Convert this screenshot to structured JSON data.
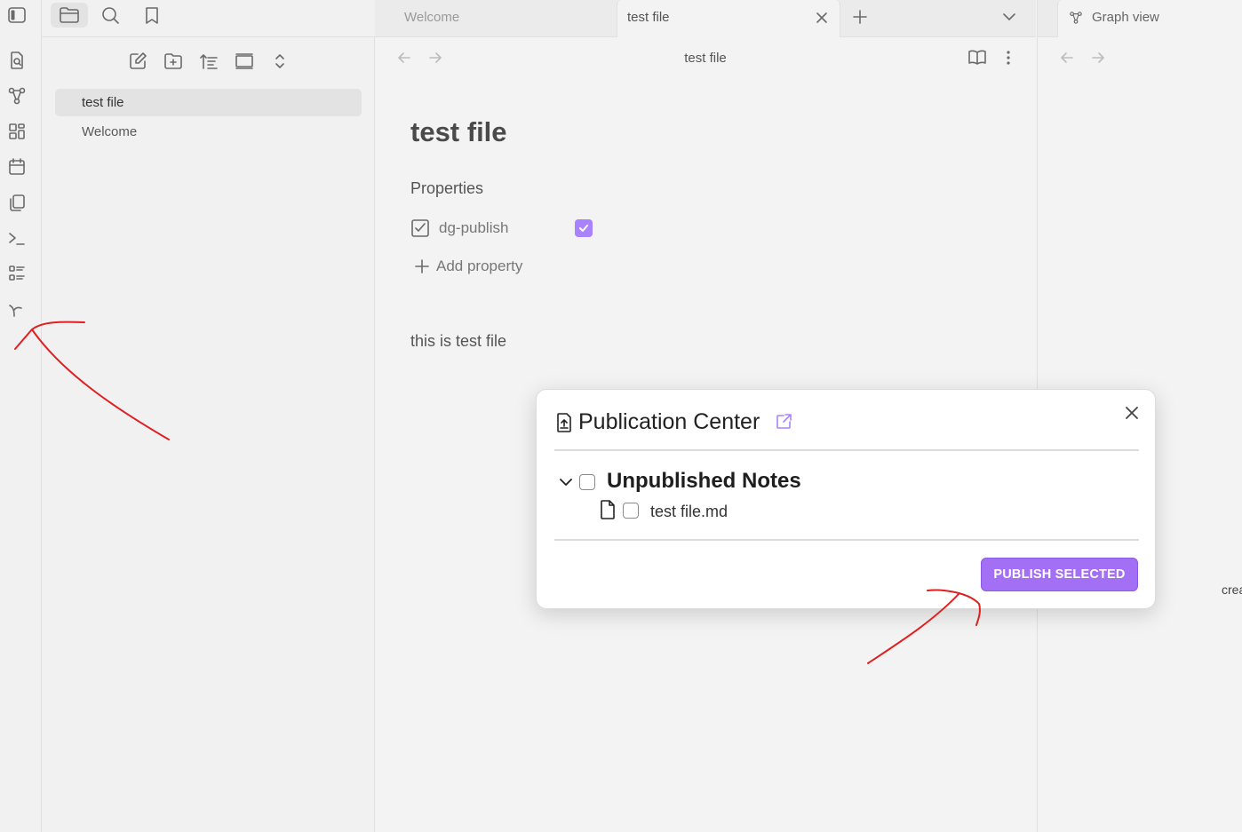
{
  "ribbon": {
    "icons": [
      "sidebar-toggle-icon",
      "search-file-icon",
      "graph-icon",
      "canvas-icon",
      "calendar-icon",
      "copy-icon",
      "terminal-icon",
      "list-icon",
      "publish-sprout-icon"
    ]
  },
  "left_panel": {
    "top_icons": [
      "folder-icon",
      "search-icon",
      "bookmark-icon"
    ],
    "nav_icons": [
      "new-note-icon",
      "new-folder-icon",
      "sort-icon",
      "collapse-icon",
      "expand-icon"
    ],
    "files": [
      {
        "label": "test file",
        "active": true
      },
      {
        "label": "Welcome",
        "active": false
      }
    ]
  },
  "tabs": [
    {
      "label": "Welcome",
      "active": false
    },
    {
      "label": "test file",
      "active": true
    }
  ],
  "note": {
    "view_title": "test file",
    "title": "test file",
    "properties_heading": "Properties",
    "property": {
      "name": "dg-publish",
      "checked": true
    },
    "add_property_label": "Add property",
    "body": "this is test file"
  },
  "right_panel": {
    "tab_label": "Graph view",
    "clipped_text": "crea"
  },
  "modal": {
    "title": "Publication Center",
    "section_label": "Unpublished Notes",
    "file_label": "test file.md",
    "publish_button": "PUBLISH SELECTED"
  },
  "colors": {
    "accent": "#a882ff",
    "button": "#a36ff5",
    "annotation": "#e02020"
  }
}
